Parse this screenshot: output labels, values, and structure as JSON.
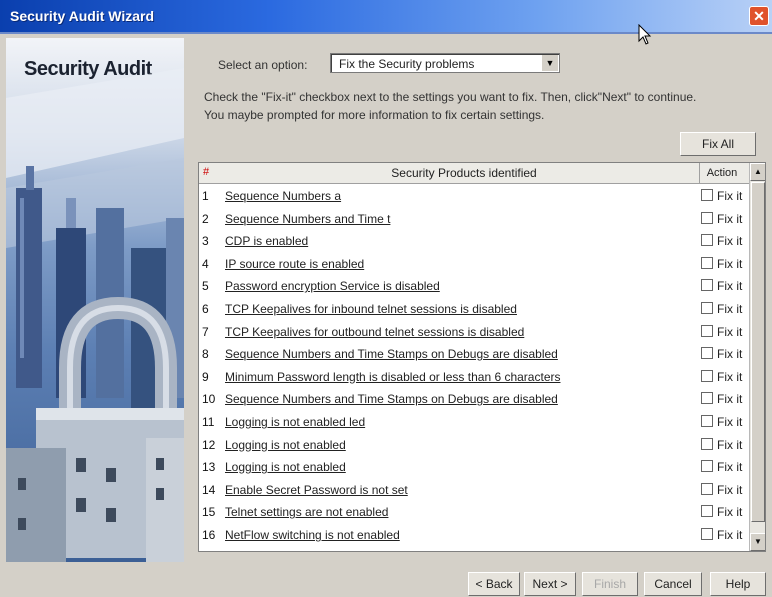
{
  "window": {
    "title": "Security Audit Wizard",
    "close_glyph": "✕"
  },
  "banner": {
    "title": "Security Audit"
  },
  "option": {
    "label": "Select an option:",
    "value": "Fix the Security problems",
    "arrow_glyph": "▼"
  },
  "instructions": {
    "line1": "Check the \"Fix-it\" checkbox next to the settings you want to fix. Then, click\"Next\" to continue.",
    "line2": "You maybe prompted for more information to fix certain settings."
  },
  "fix_all_label": "Fix All",
  "table": {
    "num_header": "#",
    "title_header": "Security Products identified",
    "action_header": "Action",
    "fix_label": "Fix it",
    "rows": [
      {
        "num": "1",
        "text": "Sequence Numbers a"
      },
      {
        "num": "2",
        "text": "Sequence Numbers and Time t"
      },
      {
        "num": "3",
        "text": "CDP is enabled"
      },
      {
        "num": "4",
        "text": "IP source route is enabled"
      },
      {
        "num": "5",
        "text": "Password encryption Service is disabled"
      },
      {
        "num": "6",
        "text": "TCP Keepalives for inbound telnet sessions is disabled"
      },
      {
        "num": "7",
        "text": "TCP Keepalives for outbound telnet sessions is disabled"
      },
      {
        "num": "8",
        "text": "Sequence Numbers and Time Stamps on Debugs are disabled"
      },
      {
        "num": "9",
        "text": "Minimum Password length is disabled or less than 6 characters"
      },
      {
        "num": "10",
        "text": "Sequence Numbers and Time Stamps on Debugs are disabled"
      },
      {
        "num": "11",
        "text": "Logging is not enabled  led"
      },
      {
        "num": "12",
        "text": "Logging is not enabled"
      },
      {
        "num": "13",
        "text": "Logging is not enabled"
      },
      {
        "num": "14",
        "text": "Enable Secret Password is not set"
      },
      {
        "num": "15",
        "text": "Telnet settings are not enabled"
      },
      {
        "num": "16",
        "text": "NetFlow switching is not enabled"
      }
    ]
  },
  "buttons": {
    "back": "< Back",
    "next": "Next >",
    "finish": "Finish",
    "cancel": "Cancel",
    "help": "Help"
  },
  "colors": {
    "titlebar": "#0a3fae",
    "close": "#e0522b",
    "disabled_text": "#a8a8a8"
  }
}
